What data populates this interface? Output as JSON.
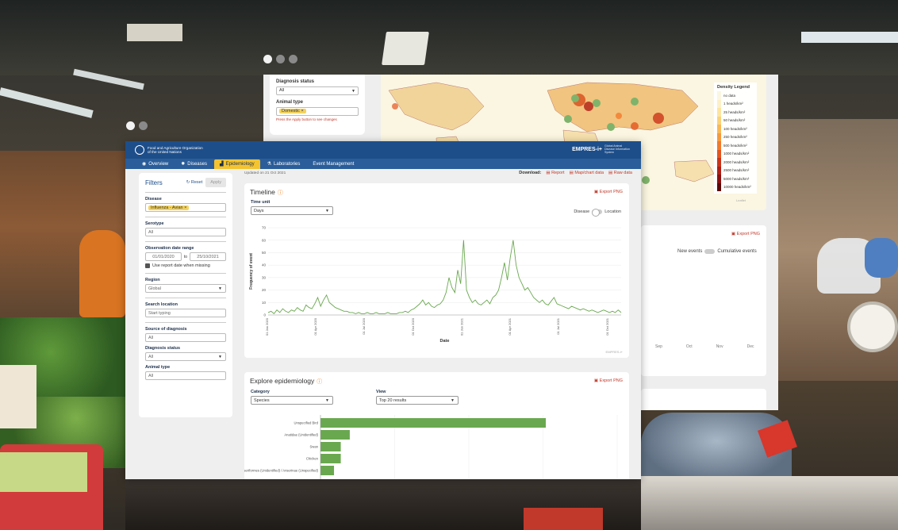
{
  "colors": {
    "header": "#1d4e8a",
    "nav": "#2a5d99",
    "tab_active": "#f4c430",
    "accent": "#c0392b",
    "series": "#6aa84f",
    "chip": "#f4d35e"
  },
  "back_panel": {
    "filters": {
      "diagnosis_status_label": "Diagnosis status",
      "diagnosis_status_value": "All",
      "animal_type_label": "Animal type",
      "animal_type_chip": "Domestic ×",
      "hint": "Press the Apply button to see changes"
    },
    "legend": {
      "title": "Density Legend",
      "items": [
        "no data",
        "1 heads/km²",
        "25 heads/km²",
        "50 heads/km²",
        "100 heads/km²",
        "250 heads/km²",
        "500 heads/km²",
        "1000 heads/km²",
        "2000 heads/km²",
        "2500 heads/km²",
        "5000 heads/km²",
        "10000 heads/km²"
      ],
      "swatches": [
        "#fbf6e1",
        "#fdf0c8",
        "#fde5a0",
        "#fbd27a",
        "#f9b856",
        "#f69a3c",
        "#f27a2c",
        "#e4561f",
        "#cc3418",
        "#b01e14",
        "#8c1010",
        "#5e0808"
      ],
      "leaflet": "Leaflet"
    },
    "card2": {
      "export_label": "Export PNG",
      "toggle_left": "New events",
      "toggle_right": "Cumulative events",
      "months": [
        "Sep",
        "Oct",
        "Nov",
        "Dec"
      ]
    }
  },
  "header": {
    "org_line1": "Food and Agriculture Organization",
    "org_line2": "of the United Nations",
    "brand": "EMPRES-i+",
    "brand_sub": "Global Animal Disease Information System"
  },
  "nav": {
    "tabs": [
      {
        "icon": "globe-icon",
        "glyph": "◉",
        "label": "Overview"
      },
      {
        "icon": "virus-icon",
        "glyph": "✹",
        "label": "Diseases"
      },
      {
        "icon": "chart-icon",
        "glyph": "▟",
        "label": "Epidemiology"
      },
      {
        "icon": "lab-icon",
        "glyph": "⚗",
        "label": "Laboratories"
      },
      {
        "icon": "event-icon",
        "glyph": "",
        "label": "Event Management"
      }
    ]
  },
  "filters": {
    "title": "Filters",
    "reset": "↻ Reset",
    "apply": "Apply",
    "disease_label": "Disease",
    "disease_chip": "Influenza - Avian ×",
    "serotype_label": "Serotype",
    "serotype_placeholder": "All",
    "date_label": "Observation date range",
    "date_from": "01/01/2020",
    "date_to_word": "to",
    "date_to": "25/10/2021",
    "use_report_date": "Use report date when missing",
    "region_label": "Region",
    "region_value": "Global",
    "search_label": "Search location",
    "search_placeholder": "Start typing",
    "source_label": "Source of diagnosis",
    "source_placeholder": "All",
    "diag_label": "Diagnosis status",
    "diag_value": "All",
    "animal_label": "Animal type",
    "animal_placeholder": "All"
  },
  "topbar": {
    "updated": "Updated on 21 Oct 2021",
    "download_label": "Download:",
    "report": "Report",
    "map_chart": "Map/chart data",
    "raw": "Raw data"
  },
  "timeline": {
    "title": "Timeline",
    "export_label": "Export PNG",
    "time_unit_label": "Time unit",
    "time_unit_value": "Days",
    "switch_left": "Disease",
    "switch_right": "Location"
  },
  "explore": {
    "title": "Explore epidemiology",
    "export_label": "Export PNG",
    "category_label": "Category",
    "category_value": "Species",
    "view_label": "View",
    "view_value": "Top 20 results"
  },
  "watermark": "EMPRES-i+",
  "chart_data": [
    {
      "type": "line",
      "xlabel": "Date",
      "ylabel": "Frequency of event",
      "ylim": [
        0,
        70
      ],
      "yticks": [
        0,
        10,
        20,
        30,
        40,
        50,
        60,
        70
      ],
      "xticks": [
        "01 Jan 2020",
        "01 Apr 2020",
        "01 Jul 2020",
        "01 Oct 2020",
        "01 Jan 2021",
        "01 Apr 2021",
        "01 Jul 2021",
        "01 Oct 2021"
      ],
      "x_start": "2020-01-01",
      "x_end": "2021-10-25",
      "series": [
        {
          "values": [
            2,
            3,
            1,
            4,
            2,
            5,
            3,
            2,
            4,
            3,
            6,
            4,
            3,
            8,
            6,
            5,
            9,
            14,
            7,
            12,
            16,
            10,
            8,
            6,
            5,
            4,
            3,
            3,
            2,
            2,
            1,
            2,
            1,
            1,
            2,
            1,
            1,
            2,
            1,
            1,
            1,
            2,
            1,
            1,
            1,
            2,
            2,
            3,
            2,
            4,
            5,
            7,
            9,
            12,
            8,
            10,
            7,
            6,
            8,
            9,
            12,
            18,
            30,
            22,
            18,
            36,
            25,
            60,
            20,
            14,
            10,
            12,
            9,
            8,
            10,
            12,
            9,
            14,
            16,
            20,
            30,
            42,
            28,
            46,
            60,
            40,
            30,
            25,
            20,
            22,
            18,
            14,
            12,
            10,
            12,
            9,
            8,
            11,
            14,
            9,
            8,
            7,
            6,
            5,
            7,
            6,
            5,
            4,
            5,
            4,
            3,
            4,
            3,
            2,
            3,
            4,
            3,
            2,
            3,
            2,
            4,
            2
          ]
        }
      ]
    },
    {
      "type": "bar",
      "orientation": "horizontal",
      "categories": [
        "Unspecified Bird",
        "Anatidae (Unidentified)",
        "Swan",
        "Chicken",
        "Anseriformes (Unidentified) / Anserinae (Unspecified)"
      ],
      "values": [
        100,
        13,
        9,
        9,
        6
      ]
    }
  ]
}
